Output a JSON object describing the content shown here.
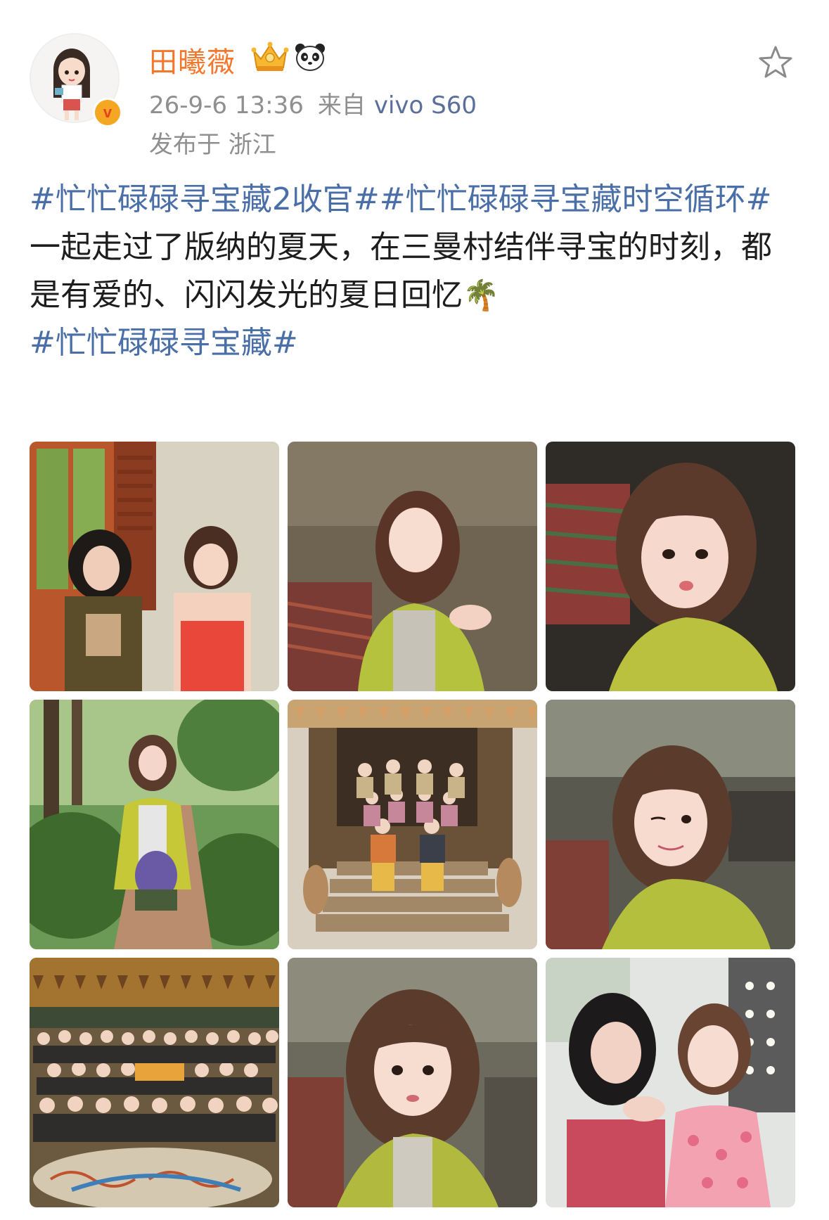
{
  "user": {
    "name": "田曦薇",
    "timestamp": "26-9-6 13:36",
    "source_prefix": "来自",
    "device": "vivo S60",
    "location": "发布于 浙江",
    "verified_icon": "v-badge",
    "badge_icons": [
      "crown-icon",
      "panda-icon"
    ]
  },
  "post": {
    "hashtag_line1": "#忙忙碌碌寻宝藏2收官##忙忙碌碌寻宝藏时空循环#",
    "body": "一起走过了版纳的夏天，在三曼村结伴寻宝的时刻，都是有爱的、闪闪发光的夏日回忆",
    "emoji": "🌴",
    "hashtag_line2": "#忙忙碌碌寻宝藏#"
  },
  "favorite_icon": "star-outline-icon",
  "colors": {
    "username": "#f4772b",
    "hashtag": "#4a6fa8",
    "meta": "#8f8f8f",
    "device": "#5a6f9a"
  },
  "photos": [
    {
      "scene": "two girls by wooden window",
      "bg": "#c9603a",
      "accent": "#e74c3c"
    },
    {
      "scene": "girl in yellow jacket, blurred crowd",
      "bg": "#7d6e55",
      "accent": "#b7c443"
    },
    {
      "scene": "girl close-up selfie, striped cloth",
      "bg": "#3d3833",
      "accent": "#b8c23a"
    },
    {
      "scene": "girl walking on garden path",
      "bg": "#4f7a3d",
      "accent": "#c4c83c"
    },
    {
      "scene": "cast group photo on stairs",
      "bg": "#8a7457",
      "accent": "#d4a05a"
    },
    {
      "scene": "girl winking, blurred background",
      "bg": "#5c5a52",
      "accent": "#b5bf3e"
    },
    {
      "scene": "crowd group photo with mural",
      "bg": "#6b5a3f",
      "accent": "#d6b35a"
    },
    {
      "scene": "girl close-up, blurred crowd",
      "bg": "#6d6b5c",
      "accent": "#b2b93f"
    },
    {
      "scene": "two girls posing together",
      "bg": "#dfe3df",
      "accent": "#e88aa0"
    }
  ]
}
